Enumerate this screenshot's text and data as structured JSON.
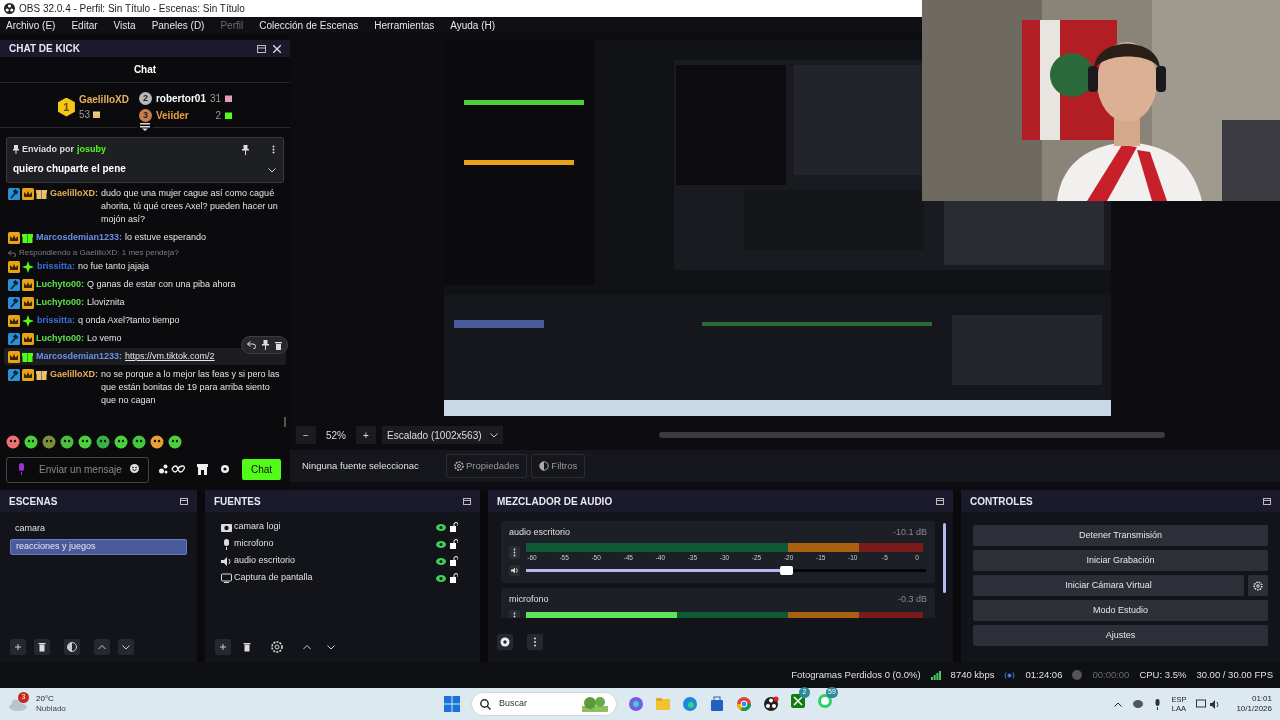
{
  "window": {
    "title": "OBS 32.0.4 - Perfil: Sin Título - Escenas: Sin Título"
  },
  "menu": [
    {
      "label": "Archivo (E)",
      "disabled": false
    },
    {
      "label": "Editar",
      "disabled": false
    },
    {
      "label": "Vista",
      "disabled": false
    },
    {
      "label": "Paneles (D)",
      "disabled": false
    },
    {
      "label": "Perfil",
      "disabled": true
    },
    {
      "label": "Colección de Escenas",
      "disabled": false
    },
    {
      "label": "Herramientas",
      "disabled": false
    },
    {
      "label": "Ayuda (H)",
      "disabled": false
    }
  ],
  "chat_dock": {
    "title": "CHAT DE KICK",
    "tab": "Chat",
    "leaderboard": [
      {
        "rank": "1",
        "name": "GaelilloXD",
        "count": "53",
        "color": "#e8b15a"
      },
      {
        "rank": "2",
        "name": "robertor01",
        "count": "31",
        "color": "#ffffff"
      },
      {
        "rank": "3",
        "name": "Veiider",
        "count": "2",
        "color": "#e8a040"
      }
    ],
    "pinned": {
      "prefix": "Enviado por",
      "user": "josuby",
      "text": "quiero chuparte el pene"
    },
    "messages": [
      {
        "badges": [
          {
            "kind": "mod"
          },
          {
            "kind": "crown"
          },
          {
            "kind": "gift",
            "color": "#e8c170"
          }
        ],
        "user": "GaelilloXD:",
        "color": "#e8b15a",
        "text": "dudo que una mujer cague así como cagué ahorita, tú qué crees Axel? pueden hacer un mojón así?",
        "hovered": false
      },
      {
        "badges": [
          {
            "kind": "crown"
          },
          {
            "kind": "gift",
            "color": "#53fc18"
          }
        ],
        "user": "Marcosdemian1233:",
        "color": "#6b8fe8",
        "text": "lo estuve esperando",
        "hovered": false
      },
      {
        "reply_to": "Respondiendo a GaelilloXD: 1 mes pendeja?",
        "badges": [
          {
            "kind": "crown"
          },
          {
            "kind": "sparkle"
          }
        ],
        "user": "brissitta:",
        "color": "#3b6fe0",
        "text": "no fue tanto jajaja",
        "hovered": false
      },
      {
        "badges": [
          {
            "kind": "mod"
          },
          {
            "kind": "crown"
          }
        ],
        "user": "Luchyto00:",
        "color": "#5ee04a",
        "text": "Q ganas de estar con una piba ahora",
        "hovered": false
      },
      {
        "badges": [
          {
            "kind": "mod"
          },
          {
            "kind": "crown"
          }
        ],
        "user": "Luchyto00:",
        "color": "#5ee04a",
        "text": "Lloviznita",
        "hovered": false
      },
      {
        "badges": [
          {
            "kind": "crown"
          },
          {
            "kind": "sparkle"
          }
        ],
        "user": "brissitta:",
        "color": "#3b6fe0",
        "text": "q onda Axel?tanto tiempo",
        "hovered": false
      },
      {
        "badges": [
          {
            "kind": "mod"
          },
          {
            "kind": "crown"
          }
        ],
        "user": "Luchyto00:",
        "color": "#5ee04a",
        "text": "Lo vemo",
        "hovered": false
      },
      {
        "badges": [
          {
            "kind": "crown"
          },
          {
            "kind": "gift",
            "color": "#53fc18"
          }
        ],
        "user": "Marcosdemian1233:",
        "color": "#6b8fe8",
        "link": "https://vm.tiktok.com/2",
        "hovered": true
      },
      {
        "badges": [
          {
            "kind": "mod"
          },
          {
            "kind": "crown"
          },
          {
            "kind": "gift",
            "color": "#e8c170"
          }
        ],
        "user": "GaelilloXD:",
        "color": "#e8b15a",
        "text": "no se porque a lo mejor las feas y si pero las que están bonitas de 19 para arriba siento que no cagan",
        "hovered": false
      }
    ],
    "input": {
      "placeholder": "Enviar un mensaje"
    },
    "send_button": "Chat"
  },
  "preview": {
    "zoom_out": "−",
    "zoom_in": "+",
    "zoom": "52%",
    "scale": "Escalado (1002x563)",
    "no_source": "Ninguna fuente seleccionac",
    "buttons": [
      "Propiedades",
      "Filtros"
    ]
  },
  "scenes": {
    "title": "ESCENAS",
    "items": [
      {
        "label": "camara",
        "selected": false
      },
      {
        "label": "reacciones y juegos",
        "selected": true
      }
    ]
  },
  "sources": {
    "title": "FUENTES",
    "items": [
      {
        "label": "camara logi",
        "kind": "camera",
        "visible": true,
        "locked": false
      },
      {
        "label": "microfono",
        "kind": "mic",
        "visible": true,
        "locked": false
      },
      {
        "label": "audio escritorio",
        "kind": "speaker",
        "visible": true,
        "locked": false
      },
      {
        "label": "Captura de pantalla",
        "kind": "display",
        "visible": true,
        "locked": false
      }
    ]
  },
  "mixer": {
    "title": "MEZCLADOR DE AUDIO",
    "scale": [
      "-60",
      "-55",
      "-50",
      "-45",
      "-40",
      "-35",
      "-30",
      "-25",
      "-20",
      "-15",
      "-10",
      "-5",
      "0"
    ],
    "channels": [
      {
        "name": "audio escritorio",
        "reading": "-10.1 dB",
        "fader": {
          "level": 0.65
        }
      },
      {
        "name": "microfono",
        "reading": "-0.3 dB",
        "meter": {
          "level": 0.38
        }
      }
    ]
  },
  "controls": {
    "title": "CONTROLES",
    "buttons": [
      {
        "label": "Detener Transmisión",
        "settings": false
      },
      {
        "label": "Iniciar Grabación",
        "settings": false
      },
      {
        "label": "Iniciar Cámara Virtual",
        "settings": true
      },
      {
        "label": "Modo Estudio",
        "settings": false
      },
      {
        "label": "Ajustes",
        "settings": false
      }
    ]
  },
  "status_bar": {
    "dropped": "Fotogramas Perdidos 0 (0.0%)",
    "bitrate": "8740 kbps",
    "stream_time": "01:24:06",
    "record_time": "00:00:00",
    "cpu": "CPU: 3.5%",
    "fps": "30.00 / 30.00 FPS"
  },
  "taskbar": {
    "weather_badge": "3",
    "temperature": "20°C",
    "condition": "Nublado",
    "search": "Buscar",
    "app_badges": [
      "2",
      "59"
    ],
    "language": [
      "ESP",
      "LAA"
    ],
    "time": "01:01",
    "date": "10/1/2026"
  }
}
